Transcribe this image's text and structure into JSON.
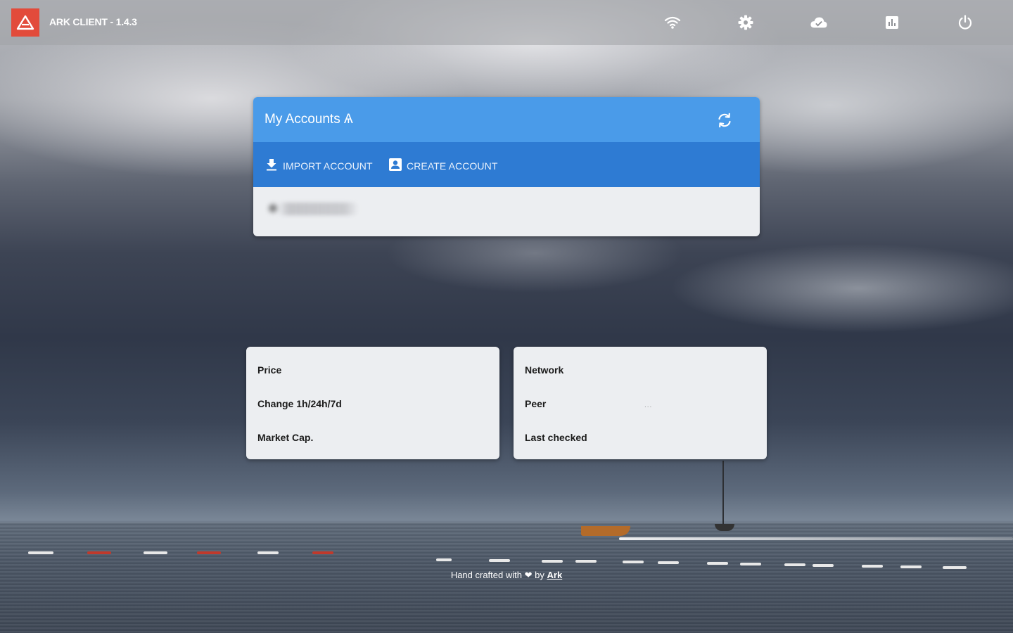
{
  "app": {
    "title": "ARK CLIENT - 1.4.3",
    "logo_icon": "ark-logo-icon",
    "brand_color": "#e24b3b"
  },
  "toolbar": {
    "icons": [
      "wifi-icon",
      "settings-icon",
      "cloud-check-icon",
      "chart-icon",
      "power-icon"
    ]
  },
  "accounts": {
    "title": "My Accounts Ѧ",
    "refresh_icon": "refresh-icon",
    "header_color": "#4a9be9",
    "actions_color": "#2e7bd3",
    "import_label": "IMPORT ACCOUNT",
    "create_label": "CREATE ACCOUNT"
  },
  "price_card": {
    "price_label": "Price",
    "change_label": "Change 1h/24h/7d",
    "market_cap_label": "Market Cap."
  },
  "network_card": {
    "network_label": "Network",
    "peer_label": "Peer",
    "peer_value": "...",
    "last_checked_label": "Last checked"
  },
  "footer": {
    "prefix": "Hand crafted with",
    "heart": "❤",
    "by": "by",
    "link": "Ark"
  }
}
